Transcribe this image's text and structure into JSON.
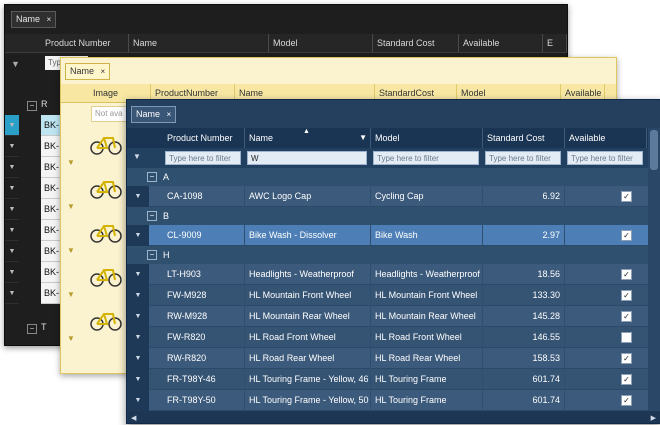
{
  "dark": {
    "group_chip": "Name",
    "columns": [
      "Product Number",
      "Name",
      "Model",
      "Standard Cost",
      "Available",
      "E"
    ],
    "filter_placeholder": "Typ",
    "group_r": "R",
    "group_t": "T",
    "rows": [
      "BK-",
      "BK-",
      "BK-",
      "BK-",
      "BK-",
      "BK-",
      "BK-",
      "BK-",
      "BK-"
    ]
  },
  "yellow": {
    "group_chip": "Name",
    "columns": [
      "Image",
      "ProductNumber",
      "Name",
      "StandardCost",
      "Model",
      "Available"
    ],
    "filter_placeholder": "Not ava"
  },
  "blue": {
    "group_chip": "Name",
    "columns": [
      "Product Number",
      "Name",
      "Model",
      "Standard Cost",
      "Available"
    ],
    "filters": {
      "product_number": "Type here to filter",
      "name": "W",
      "model": "Type here to filter",
      "standard_cost": "Type here to filter",
      "available": "Type here to filter"
    },
    "groups": [
      {
        "key": "A",
        "rows": [
          {
            "pn": "CA-1098",
            "name": "AWC Logo Cap",
            "model": "Cycling Cap",
            "cost": "6.92",
            "available": true
          }
        ]
      },
      {
        "key": "B",
        "rows": [
          {
            "pn": "CL-9009",
            "name": "Bike Wash - Dissolver",
            "model": "Bike Wash",
            "cost": "2.97",
            "available": true
          }
        ]
      },
      {
        "key": "H",
        "rows": [
          {
            "pn": "LT-H903",
            "name": "Headlights - Weatherproof",
            "model": "Headlights - Weatherproof",
            "cost": "18.56",
            "available": true
          },
          {
            "pn": "FW-M928",
            "name": "HL Mountain Front Wheel",
            "model": "HL Mountain Front Wheel",
            "cost": "133.30",
            "available": true
          },
          {
            "pn": "RW-M928",
            "name": "HL Mountain Rear Wheel",
            "model": "HL Mountain Rear Wheel",
            "cost": "145.28",
            "available": true
          },
          {
            "pn": "FW-R820",
            "name": "HL Road Front Wheel",
            "model": "HL Road Front Wheel",
            "cost": "146.55",
            "available": false
          },
          {
            "pn": "RW-R820",
            "name": "HL Road Rear Wheel",
            "model": "HL Road Rear Wheel",
            "cost": "158.53",
            "available": true
          },
          {
            "pn": "FR-T98Y-46",
            "name": "HL Touring Frame - Yellow, 46",
            "model": "HL Touring Frame",
            "cost": "601.74",
            "available": true
          },
          {
            "pn": "FR-T98Y-50",
            "name": "HL Touring Frame - Yellow, 50",
            "model": "HL Touring Frame",
            "cost": "601.74",
            "available": true
          }
        ]
      }
    ]
  },
  "colors": {
    "dark_bg": "#1e1e1e",
    "yellow_bg": "#fbf3cf",
    "blue_bg": "#253f5e",
    "blue_selected": "#4d7fb6"
  }
}
